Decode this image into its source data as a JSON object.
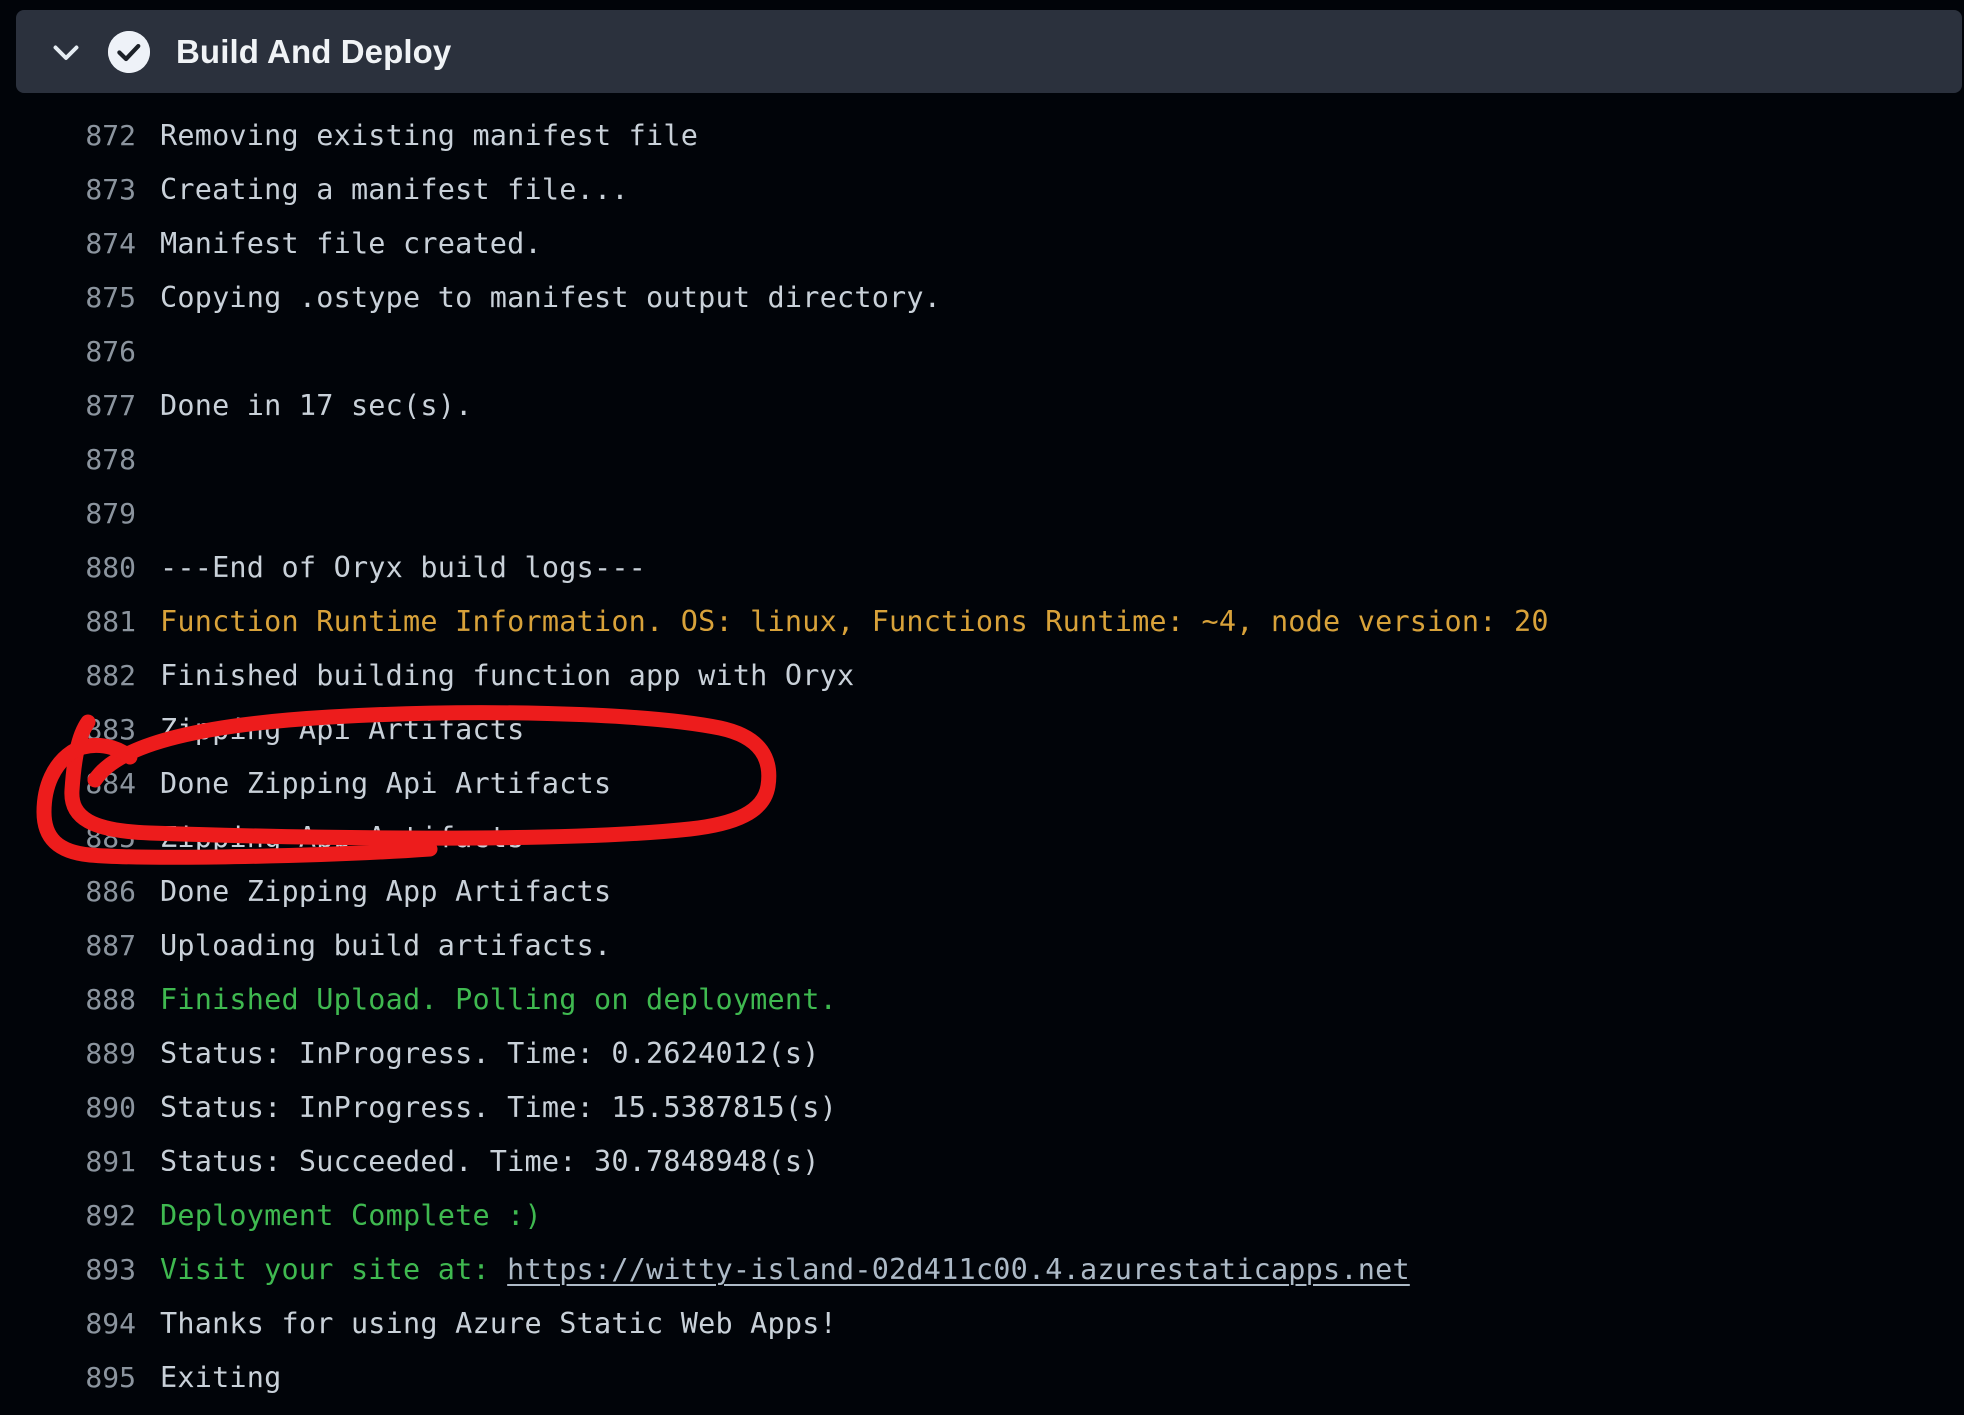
{
  "header": {
    "title": "Build And Deploy",
    "status_icon": "check-circle-icon",
    "expand_icon": "chevron-down-icon",
    "expanded": true,
    "bar_color": "#2b313d",
    "badge_color": "#eef2f8"
  },
  "colors": {
    "background": "#010409",
    "default_text": "#c9d1d9",
    "line_number": "#8b949e",
    "warning_orange": "#d8a23a",
    "success_green": "#3fb950",
    "annotation_red": "#ed1c1c",
    "link": "#adbac7"
  },
  "annotation": {
    "shape": "hand-drawn-ellipse",
    "color": "#ed1c1c",
    "stroke_width": 15,
    "targets_line": "884",
    "target_text": "Done Zipping Api Artifacts"
  },
  "log": {
    "lines": [
      {
        "n": "872",
        "text": "Removing existing manifest file",
        "color": "c-white"
      },
      {
        "n": "873",
        "text": "Creating a manifest file...",
        "color": "c-white"
      },
      {
        "n": "874",
        "text": "Manifest file created.",
        "color": "c-white"
      },
      {
        "n": "875",
        "text": "Copying .ostype to manifest output directory.",
        "color": "c-white"
      },
      {
        "n": "876",
        "text": "",
        "color": "c-white"
      },
      {
        "n": "877",
        "text": "Done in 17 sec(s).",
        "color": "c-white"
      },
      {
        "n": "878",
        "text": "",
        "color": "c-white"
      },
      {
        "n": "879",
        "text": "",
        "color": "c-white"
      },
      {
        "n": "880",
        "text": "---End of Oryx build logs---",
        "color": "c-white"
      },
      {
        "n": "881",
        "text": "Function Runtime Information. OS: linux, Functions Runtime: ~4, node version: 20",
        "color": "c-orange"
      },
      {
        "n": "882",
        "text": "Finished building function app with Oryx",
        "color": "c-white"
      },
      {
        "n": "883",
        "text": "Zipping Api Artifacts",
        "color": "c-white"
      },
      {
        "n": "884",
        "text": "Done Zipping Api Artifacts",
        "color": "c-white"
      },
      {
        "n": "885",
        "text": "Zipping App Artifacts",
        "color": "c-white"
      },
      {
        "n": "886",
        "text": "Done Zipping App Artifacts",
        "color": "c-white"
      },
      {
        "n": "887",
        "text": "Uploading build artifacts.",
        "color": "c-white"
      },
      {
        "n": "888",
        "text": "Finished Upload. Polling on deployment.",
        "color": "c-green"
      },
      {
        "n": "889",
        "text": "Status: InProgress. Time: 0.2624012(s)",
        "color": "c-white"
      },
      {
        "n": "890",
        "text": "Status: InProgress. Time: 15.5387815(s)",
        "color": "c-white"
      },
      {
        "n": "891",
        "text": "Status: Succeeded. Time: 30.7848948(s)",
        "color": "c-white"
      },
      {
        "n": "892",
        "text": "Deployment Complete :)",
        "color": "c-green"
      },
      {
        "n": "893",
        "text": "Visit your site at: ",
        "color": "c-green",
        "link": "https://witty-island-02d411c00.4.azurestaticapps.net"
      },
      {
        "n": "894",
        "text": "Thanks for using Azure Static Web Apps!",
        "color": "c-white"
      },
      {
        "n": "895",
        "text": "Exiting",
        "color": "c-white"
      }
    ]
  }
}
